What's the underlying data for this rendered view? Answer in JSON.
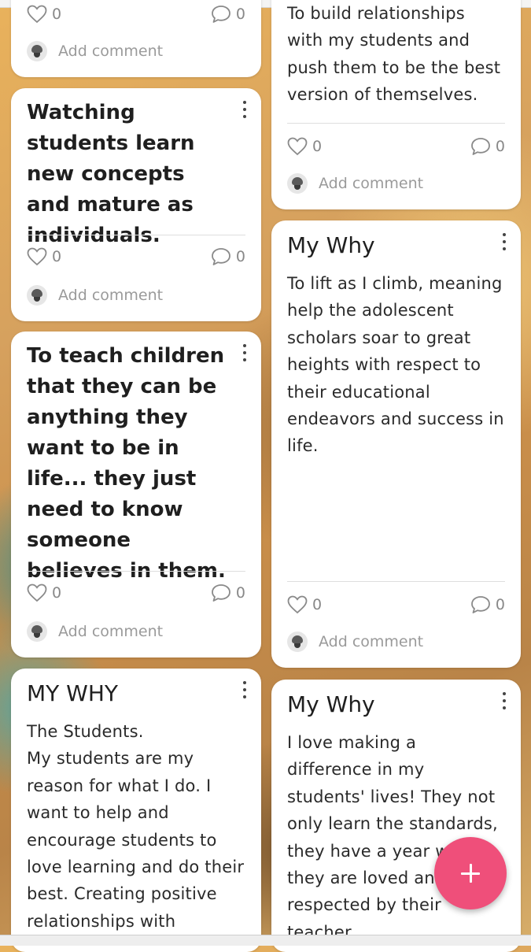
{
  "cards": [
    {
      "id": "c1",
      "likes": "0",
      "comments": "0",
      "add_comment": "Add comment"
    },
    {
      "id": "c2",
      "body": "To build relationships with my students and push them to be the best version of themselves.",
      "likes": "0",
      "comments": "0",
      "add_comment": "Add comment"
    },
    {
      "id": "c3",
      "title": "Watching students learn new concepts and mature as individuals.",
      "likes": "0",
      "comments": "0",
      "add_comment": "Add comment"
    },
    {
      "id": "c4",
      "title": "My Why",
      "body": "To lift as I climb, meaning help the adolescent scholars soar to great heights with respect to their educational endeavors and success in life.",
      "likes": "0",
      "comments": "0",
      "add_comment": "Add comment"
    },
    {
      "id": "c5",
      "title": "To teach children that they can be anything they want to be in life... they just need to know someone believes in them.",
      "likes": "0",
      "comments": "0",
      "add_comment": "Add comment"
    },
    {
      "id": "c6",
      "title": "MY WHY",
      "body": "The Students.\nMy students are my reason for what I do. I want to help and encourage students to love learning and do their best. Creating positive relationships with"
    },
    {
      "id": "c7",
      "title": "My Why",
      "body": "I love making a difference in my students' lives! They not only learn the standards, they have a year where they are loved and respected by their teacher."
    }
  ],
  "icons": {
    "heart": "heart-outline-icon",
    "comment": "comment-bubble-icon",
    "menu": "more-vertical-icon",
    "add": "plus-icon"
  },
  "colors": {
    "fab": "#ef4f7a",
    "card_bg": "#ffffff",
    "icon_gray": "#888888"
  }
}
